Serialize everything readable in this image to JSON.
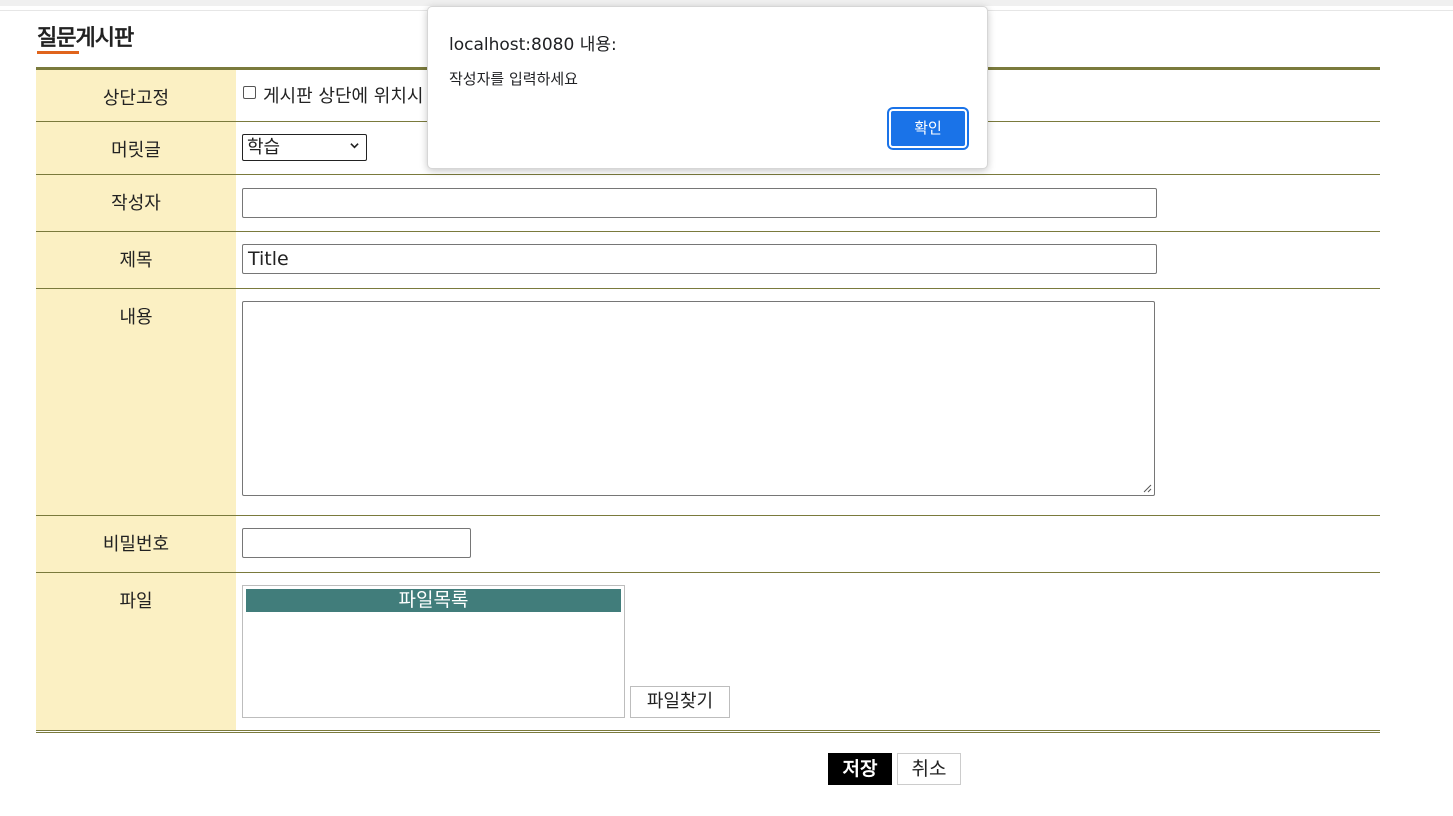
{
  "page": {
    "title": "질문게시판"
  },
  "form": {
    "pin": {
      "label": "상단고정",
      "checkbox_text": "게시판 상단에 위치시"
    },
    "header": {
      "label": "머릿글",
      "selected": "학습"
    },
    "author": {
      "label": "작성자",
      "value": ""
    },
    "title": {
      "label": "제목",
      "value": "Title"
    },
    "content": {
      "label": "내용",
      "value": ""
    },
    "password": {
      "label": "비밀번호",
      "value": ""
    },
    "file": {
      "label": "파일",
      "list_header": "파일목록",
      "find_button": "파일찾기"
    }
  },
  "actions": {
    "save": "저장",
    "cancel": "취소"
  },
  "dialog": {
    "title": "localhost:8080 내용:",
    "message": "작성자를 입력하세요",
    "ok": "확인"
  },
  "colors": {
    "label_bg": "#fbf0c3",
    "border": "#7a7a3c",
    "title_accent": "#e0641c",
    "file_header": "#417d7b",
    "dialog_button": "#1a73e8"
  }
}
